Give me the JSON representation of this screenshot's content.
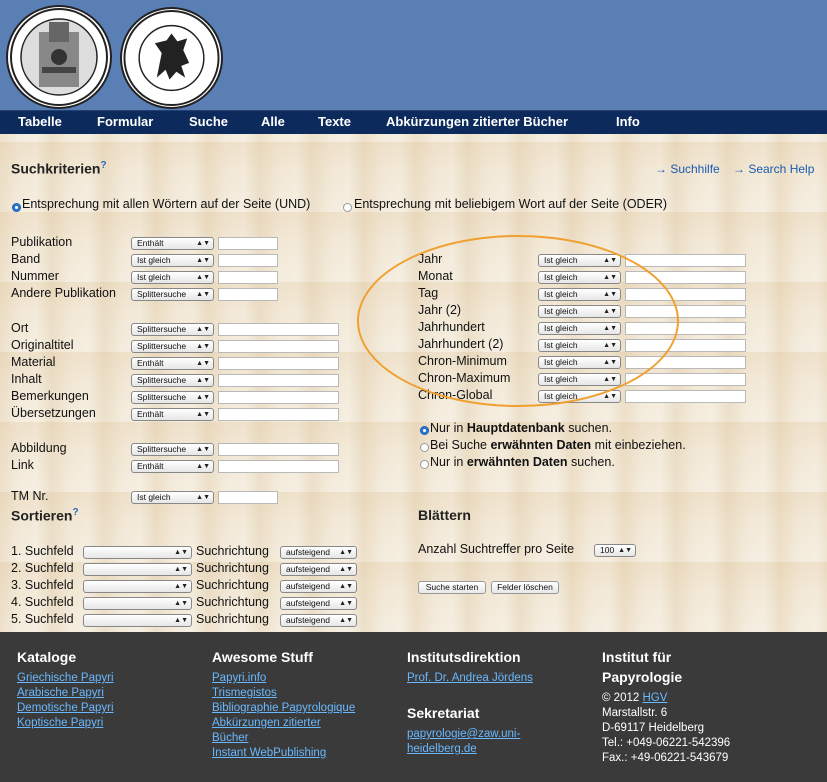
{
  "nav": [
    "Tabelle",
    "Formular",
    "Suche",
    "Alle",
    "Texte",
    "Abkürzungen zitierter Bücher",
    "Info"
  ],
  "search": {
    "title": "Suchkriterien",
    "qmark": "?",
    "help1": "→ Suchhilfe",
    "help2": "→ Search Help",
    "mode_and": "Entsprechung mit allen Wörtern auf der Seite (UND)",
    "mode_or": "Entsprechung mit beliebigem Wort auf der Seite (ODER)"
  },
  "left_fields": [
    {
      "label": "Publikation",
      "op": "Enthält",
      "narrow": true
    },
    {
      "label": "Band",
      "op": "Ist gleich",
      "narrow": true
    },
    {
      "label": "Nummer",
      "op": "Ist gleich",
      "narrow": true
    },
    {
      "label": "Andere Publikation",
      "op": "Splittersuche",
      "narrow": true
    },
    {
      "label": "Ort",
      "op": "Splittersuche",
      "narrow": false
    },
    {
      "label": "Originaltitel",
      "op": "Splittersuche",
      "narrow": false
    },
    {
      "label": "Material",
      "op": "Enthält",
      "narrow": false
    },
    {
      "label": "Inhalt",
      "op": "Splittersuche",
      "narrow": false
    },
    {
      "label": "Bemerkungen",
      "op": "Splittersuche",
      "narrow": false
    },
    {
      "label": "Übersetzungen",
      "op": "Enthält",
      "narrow": false
    },
    {
      "label": "Abbildung",
      "op": "Splittersuche",
      "narrow": false
    },
    {
      "label": "Link",
      "op": "Enthält",
      "narrow": false
    },
    {
      "label": "TM Nr.",
      "op": "Ist gleich",
      "narrow": true
    }
  ],
  "right_fields": [
    {
      "label": "Jahr",
      "op": "Ist gleich"
    },
    {
      "label": "Monat",
      "op": "Ist gleich"
    },
    {
      "label": "Tag",
      "op": "Ist gleich"
    },
    {
      "label": "Jahr (2)",
      "op": "Ist gleich"
    },
    {
      "label": "Jahrhundert",
      "op": "Ist gleich"
    },
    {
      "label": "Jahrhundert (2)",
      "op": "Ist gleich"
    },
    {
      "label": "Chron-Minimum",
      "op": "Ist gleich"
    },
    {
      "label": "Chron-Maximum",
      "op": "Ist gleich"
    },
    {
      "label": "Chron-Global",
      "op": "Ist gleich"
    }
  ],
  "db": {
    "opt1_pre": "Nur in ",
    "opt1_bold": "Hauptdatenbank",
    "opt1_post": " suchen.",
    "opt2_pre": "Bei Suche ",
    "opt2_bold": "erwähnten Daten",
    "opt2_post": " mit einbeziehen.",
    "opt3_pre": "Nur in ",
    "opt3_bold": "erwähnten Daten",
    "opt3_post": " suchen."
  },
  "sort": {
    "title": "Sortieren",
    "qmark": "?",
    "rows": [
      {
        "label": "1. Suchfeld",
        "dir_label": "Suchrichtung",
        "dir": "aufsteigend"
      },
      {
        "label": "2. Suchfeld",
        "dir_label": "Suchrichtung",
        "dir": "aufsteigend"
      },
      {
        "label": "3. Suchfeld",
        "dir_label": "Suchrichtung",
        "dir": "aufsteigend"
      },
      {
        "label": "4. Suchfeld",
        "dir_label": "Suchrichtung",
        "dir": "aufsteigend"
      },
      {
        "label": "5. Suchfeld",
        "dir_label": "Suchrichtung",
        "dir": "aufsteigend"
      }
    ]
  },
  "paging": {
    "title": "Blättern",
    "label": "Anzahl Suchtreffer pro Seite",
    "value": "100",
    "start": "Suche starten",
    "clear": "Felder löschen"
  },
  "footer": {
    "col1_title": "Kataloge",
    "col1_links": [
      "Griechische Papyri",
      "Arabische Papyri",
      "Demotische Papyri",
      "Koptische Papyri"
    ],
    "col2_title": "Awesome Stuff",
    "col2_links": [
      "Papyri.info",
      "Trismegistos",
      "Bibliographie Papyrologique",
      "Abkürzungen zitierter",
      "Bücher",
      "Instant WebPublishing"
    ],
    "col3_title": "Institutsdirektion",
    "col3_link": "Prof. Dr. Andrea Jördens",
    "col3_title2": "Sekretariat",
    "col3_mail1": "papyrologie@zaw.uni-",
    "col3_mail2": "heidelberg.de",
    "col4_title1": "Institut für",
    "col4_title2": "Papyrologie",
    "copy_pre": "© 2012 ",
    "copy_link": "HGV",
    "addr": [
      "Marstallstr. 6",
      "D-69117 Heidelberg",
      "Tel.: +049-06221-542396",
      "Fax.: +49-06221-543679"
    ]
  },
  "colors": {
    "header": "#5a7fb5",
    "nav": "#0d2a5c",
    "footer": "#3a3a3a",
    "link": "#6ab8ff",
    "highlight": "#f0a030"
  }
}
